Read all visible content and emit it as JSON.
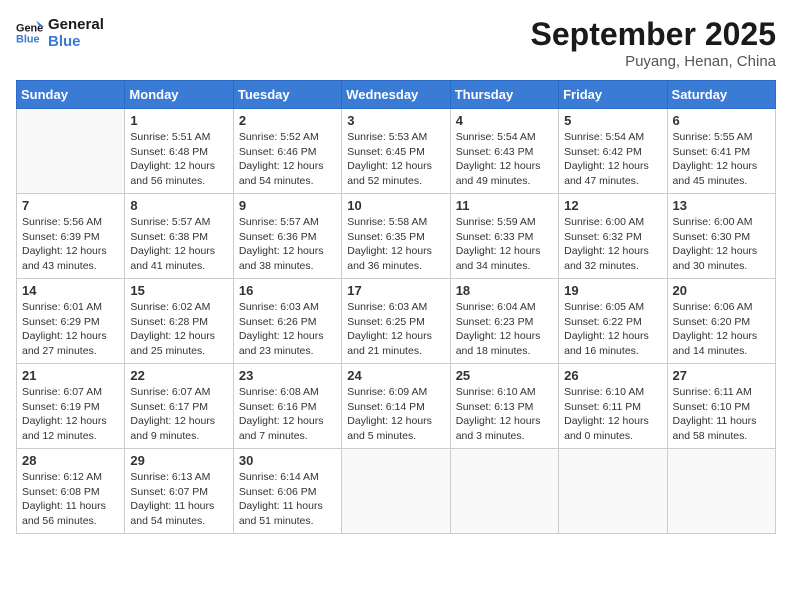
{
  "header": {
    "logo_general": "General",
    "logo_blue": "Blue",
    "month_title": "September 2025",
    "location": "Puyang, Henan, China"
  },
  "weekdays": [
    "Sunday",
    "Monday",
    "Tuesday",
    "Wednesday",
    "Thursday",
    "Friday",
    "Saturday"
  ],
  "weeks": [
    [
      {
        "day": "",
        "sunrise": "",
        "sunset": "",
        "daylight": ""
      },
      {
        "day": "1",
        "sunrise": "Sunrise: 5:51 AM",
        "sunset": "Sunset: 6:48 PM",
        "daylight": "Daylight: 12 hours and 56 minutes."
      },
      {
        "day": "2",
        "sunrise": "Sunrise: 5:52 AM",
        "sunset": "Sunset: 6:46 PM",
        "daylight": "Daylight: 12 hours and 54 minutes."
      },
      {
        "day": "3",
        "sunrise": "Sunrise: 5:53 AM",
        "sunset": "Sunset: 6:45 PM",
        "daylight": "Daylight: 12 hours and 52 minutes."
      },
      {
        "day": "4",
        "sunrise": "Sunrise: 5:54 AM",
        "sunset": "Sunset: 6:43 PM",
        "daylight": "Daylight: 12 hours and 49 minutes."
      },
      {
        "day": "5",
        "sunrise": "Sunrise: 5:54 AM",
        "sunset": "Sunset: 6:42 PM",
        "daylight": "Daylight: 12 hours and 47 minutes."
      },
      {
        "day": "6",
        "sunrise": "Sunrise: 5:55 AM",
        "sunset": "Sunset: 6:41 PM",
        "daylight": "Daylight: 12 hours and 45 minutes."
      }
    ],
    [
      {
        "day": "7",
        "sunrise": "Sunrise: 5:56 AM",
        "sunset": "Sunset: 6:39 PM",
        "daylight": "Daylight: 12 hours and 43 minutes."
      },
      {
        "day": "8",
        "sunrise": "Sunrise: 5:57 AM",
        "sunset": "Sunset: 6:38 PM",
        "daylight": "Daylight: 12 hours and 41 minutes."
      },
      {
        "day": "9",
        "sunrise": "Sunrise: 5:57 AM",
        "sunset": "Sunset: 6:36 PM",
        "daylight": "Daylight: 12 hours and 38 minutes."
      },
      {
        "day": "10",
        "sunrise": "Sunrise: 5:58 AM",
        "sunset": "Sunset: 6:35 PM",
        "daylight": "Daylight: 12 hours and 36 minutes."
      },
      {
        "day": "11",
        "sunrise": "Sunrise: 5:59 AM",
        "sunset": "Sunset: 6:33 PM",
        "daylight": "Daylight: 12 hours and 34 minutes."
      },
      {
        "day": "12",
        "sunrise": "Sunrise: 6:00 AM",
        "sunset": "Sunset: 6:32 PM",
        "daylight": "Daylight: 12 hours and 32 minutes."
      },
      {
        "day": "13",
        "sunrise": "Sunrise: 6:00 AM",
        "sunset": "Sunset: 6:30 PM",
        "daylight": "Daylight: 12 hours and 30 minutes."
      }
    ],
    [
      {
        "day": "14",
        "sunrise": "Sunrise: 6:01 AM",
        "sunset": "Sunset: 6:29 PM",
        "daylight": "Daylight: 12 hours and 27 minutes."
      },
      {
        "day": "15",
        "sunrise": "Sunrise: 6:02 AM",
        "sunset": "Sunset: 6:28 PM",
        "daylight": "Daylight: 12 hours and 25 minutes."
      },
      {
        "day": "16",
        "sunrise": "Sunrise: 6:03 AM",
        "sunset": "Sunset: 6:26 PM",
        "daylight": "Daylight: 12 hours and 23 minutes."
      },
      {
        "day": "17",
        "sunrise": "Sunrise: 6:03 AM",
        "sunset": "Sunset: 6:25 PM",
        "daylight": "Daylight: 12 hours and 21 minutes."
      },
      {
        "day": "18",
        "sunrise": "Sunrise: 6:04 AM",
        "sunset": "Sunset: 6:23 PM",
        "daylight": "Daylight: 12 hours and 18 minutes."
      },
      {
        "day": "19",
        "sunrise": "Sunrise: 6:05 AM",
        "sunset": "Sunset: 6:22 PM",
        "daylight": "Daylight: 12 hours and 16 minutes."
      },
      {
        "day": "20",
        "sunrise": "Sunrise: 6:06 AM",
        "sunset": "Sunset: 6:20 PM",
        "daylight": "Daylight: 12 hours and 14 minutes."
      }
    ],
    [
      {
        "day": "21",
        "sunrise": "Sunrise: 6:07 AM",
        "sunset": "Sunset: 6:19 PM",
        "daylight": "Daylight: 12 hours and 12 minutes."
      },
      {
        "day": "22",
        "sunrise": "Sunrise: 6:07 AM",
        "sunset": "Sunset: 6:17 PM",
        "daylight": "Daylight: 12 hours and 9 minutes."
      },
      {
        "day": "23",
        "sunrise": "Sunrise: 6:08 AM",
        "sunset": "Sunset: 6:16 PM",
        "daylight": "Daylight: 12 hours and 7 minutes."
      },
      {
        "day": "24",
        "sunrise": "Sunrise: 6:09 AM",
        "sunset": "Sunset: 6:14 PM",
        "daylight": "Daylight: 12 hours and 5 minutes."
      },
      {
        "day": "25",
        "sunrise": "Sunrise: 6:10 AM",
        "sunset": "Sunset: 6:13 PM",
        "daylight": "Daylight: 12 hours and 3 minutes."
      },
      {
        "day": "26",
        "sunrise": "Sunrise: 6:10 AM",
        "sunset": "Sunset: 6:11 PM",
        "daylight": "Daylight: 12 hours and 0 minutes."
      },
      {
        "day": "27",
        "sunrise": "Sunrise: 6:11 AM",
        "sunset": "Sunset: 6:10 PM",
        "daylight": "Daylight: 11 hours and 58 minutes."
      }
    ],
    [
      {
        "day": "28",
        "sunrise": "Sunrise: 6:12 AM",
        "sunset": "Sunset: 6:08 PM",
        "daylight": "Daylight: 11 hours and 56 minutes."
      },
      {
        "day": "29",
        "sunrise": "Sunrise: 6:13 AM",
        "sunset": "Sunset: 6:07 PM",
        "daylight": "Daylight: 11 hours and 54 minutes."
      },
      {
        "day": "30",
        "sunrise": "Sunrise: 6:14 AM",
        "sunset": "Sunset: 6:06 PM",
        "daylight": "Daylight: 11 hours and 51 minutes."
      },
      {
        "day": "",
        "sunrise": "",
        "sunset": "",
        "daylight": ""
      },
      {
        "day": "",
        "sunrise": "",
        "sunset": "",
        "daylight": ""
      },
      {
        "day": "",
        "sunrise": "",
        "sunset": "",
        "daylight": ""
      },
      {
        "day": "",
        "sunrise": "",
        "sunset": "",
        "daylight": ""
      }
    ]
  ]
}
